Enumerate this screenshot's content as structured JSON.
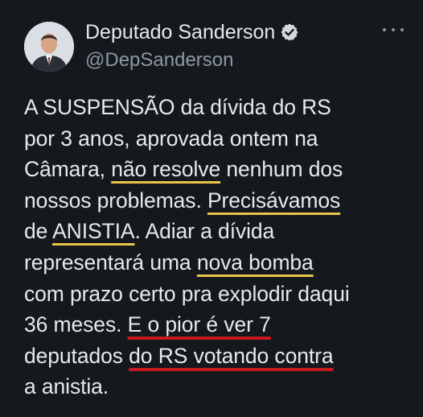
{
  "author": {
    "name": "Deputado Sanderson",
    "handle": "@DepSanderson",
    "verified_icon": "verified-badge-icon",
    "avatar": "profile-photo"
  },
  "menu_icon": "more-horizontal-icon",
  "colors": {
    "background": "#15181c",
    "text": "#e7e9ea",
    "secondary": "#8b98a5",
    "underline_yellow": "#e8c54a",
    "underline_red": "#c8191f"
  },
  "tweet": {
    "l1": "A SUSPENSÃO da dívida do RS",
    "l2": "por 3 anos, aprovada ontem na",
    "l3a": "Câmara, ",
    "l3b": "não resolve",
    "l3c": " nenhum dos",
    "l4a": "nossos problemas. ",
    "l4b": "Precisávamos",
    "l5a": "de ",
    "l5b": "ANISTIA",
    "l5c": ". Adiar a dívida",
    "l6a": "representará uma ",
    "l6b": "nova bomba",
    "l7": "com prazo certo pra explodir daqui",
    "l8a": "36 meses. ",
    "l8b": "E o pior é ver 7",
    "l9a": "deputados ",
    "l9b": "do RS votando contra",
    "l10": "a anistia."
  }
}
